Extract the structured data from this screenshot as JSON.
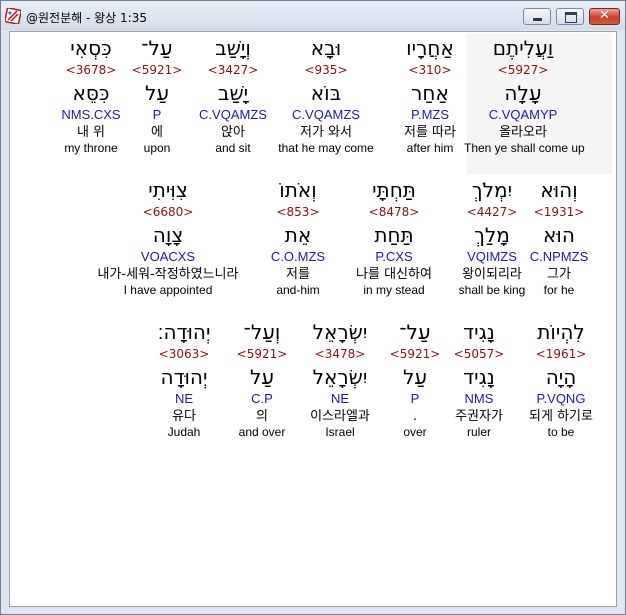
{
  "window": {
    "title": "@원전분해 - 왕상 1:35",
    "controls": {
      "minimize": "minimize",
      "maximize": "maximize",
      "close": "✕"
    }
  },
  "rows": [
    {
      "words": [
        {
          "hebrew": "וַעֲלִיתֶם",
          "strong": "<5927>",
          "lemma": "עָלָה",
          "morph": "C.VQAMYP",
          "korean": "올라오라",
          "english": "Then ye shall come up"
        },
        {
          "hebrew": "אַחֲרָיו",
          "strong": "<310>",
          "lemma": "אַחַר",
          "morph": "P.MZS",
          "korean": "저를 따라",
          "english": "after him"
        },
        {
          "hebrew": "וּבָא",
          "strong": "<935>",
          "lemma": "בּוֹא",
          "morph": "C.VQAMZS",
          "korean": "저가 와서",
          "english": "that he may come"
        },
        {
          "hebrew": "וְיָשַׁב",
          "strong": "<3427>",
          "lemma": "יָשַׁב",
          "morph": "C.VQAMZS",
          "korean": "앉아",
          "english": "and sit"
        },
        {
          "hebrew": "עַל־",
          "strong": "<5921>",
          "lemma": "עַל",
          "morph": "P",
          "korean": "에",
          "english": "upon"
        },
        {
          "hebrew": "כִּסְאִי",
          "strong": "<3678>",
          "lemma": "כִּסֵּא",
          "morph": "NMS.CXS",
          "korean": "내 위",
          "english": "my throne"
        }
      ]
    },
    {
      "words": [
        {
          "hebrew": "וְהוּא",
          "strong": "<1931>",
          "lemma": "הוּא",
          "morph": "C.NPMZS",
          "korean": "그가",
          "english": "for he"
        },
        {
          "hebrew": "יִמְלֹךְ",
          "strong": "<4427>",
          "lemma": "מָלַךְ",
          "morph": "VQIMZS",
          "korean": "왕이되리라",
          "english": "shall be king"
        },
        {
          "hebrew": "תַּחְתָּי",
          "strong": "<8478>",
          "lemma": "תַּחַת",
          "morph": "P.CXS",
          "korean": "나를 대신하여",
          "english": "in my stead"
        },
        {
          "hebrew": "וְאֹתוֹ",
          "strong": "<853>",
          "lemma": "אֵת",
          "morph": "C.O.MZS",
          "korean": "저를",
          "english": "and-him"
        },
        {
          "hebrew": "צִוִּיתִי",
          "strong": "<6680>",
          "lemma": "צָוָה",
          "morph": "VOACXS",
          "korean": "내가-세워-작정하였느니라",
          "english": "I have appointed"
        }
      ]
    },
    {
      "words": [
        {
          "hebrew": "לִהְיוֹת",
          "strong": "<1961>",
          "lemma": "הָיָה",
          "morph": "P.VQNG",
          "korean": "되게 하기로",
          "english": "to be"
        },
        {
          "hebrew": "נָגִיד",
          "strong": "<5057>",
          "lemma": "נָגִיד",
          "morph": "NMS",
          "korean": "주권자가",
          "english": "ruler"
        },
        {
          "hebrew": "עַל־",
          "strong": "<5921>",
          "lemma": "עַל",
          "morph": "P",
          "korean": ".",
          "english": "over"
        },
        {
          "hebrew": "יִשְׂרָאֵל",
          "strong": "<3478>",
          "lemma": "יִשְׂרָאֵל",
          "morph": "NE",
          "korean": "이스라엘과",
          "english": "Israel"
        },
        {
          "hebrew": "וְעַל־",
          "strong": "<5921>",
          "lemma": "עַל",
          "morph": "C.P",
          "korean": "의",
          "english": "and over"
        },
        {
          "hebrew": "יְהוּדָה׃",
          "strong": "<3063>",
          "lemma": "יְהוּדָה",
          "morph": "NE",
          "korean": "유다",
          "english": "Judah"
        }
      ]
    }
  ]
}
